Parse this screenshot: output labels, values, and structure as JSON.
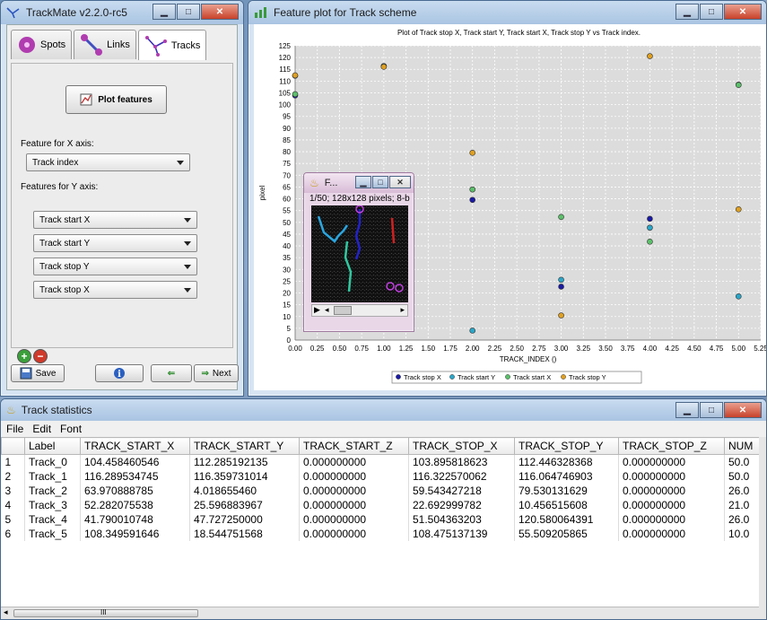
{
  "trackmate": {
    "title": "TrackMate v2.2.0-rc5",
    "tabs": [
      {
        "label": "Spots"
      },
      {
        "label": "Links"
      },
      {
        "label": "Tracks"
      }
    ],
    "plot_button": "Plot features",
    "x_axis_label": "Feature for X axis:",
    "x_axis_value": "Track index",
    "y_axis_label": "Features for Y axis:",
    "y_features": [
      "Track start X",
      "Track start Y",
      "Track stop Y",
      "Track stop X"
    ],
    "buttons": {
      "save": "Save",
      "next": "Next"
    }
  },
  "plot_window": {
    "title": "Feature plot for Track scheme"
  },
  "chart_data": {
    "type": "scatter",
    "title": "Plot of Track stop X, Track start Y, Track start X, Track stop Y vs Track index.",
    "xlabel": "TRACK_INDEX ()",
    "ylabel": "pixel",
    "xlim": [
      0,
      5.25
    ],
    "ylim": [
      0,
      125
    ],
    "xticks": [
      "0.00",
      "0.25",
      "0.50",
      "0.75",
      "1.00",
      "1.25",
      "1.50",
      "1.75",
      "2.00",
      "2.25",
      "2.50",
      "2.75",
      "3.00",
      "3.25",
      "3.50",
      "3.75",
      "4.00",
      "4.25",
      "4.50",
      "4.75",
      "5.00",
      "5.25"
    ],
    "yticks": [
      "0",
      "5",
      "10",
      "15",
      "20",
      "25",
      "30",
      "35",
      "40",
      "45",
      "50",
      "55",
      "60",
      "65",
      "70",
      "75",
      "80",
      "85",
      "90",
      "95",
      "100",
      "105",
      "110",
      "115",
      "120",
      "125"
    ],
    "grid": true,
    "legend_position": "bottom",
    "x": [
      0,
      1,
      2,
      3,
      4,
      5
    ],
    "series": [
      {
        "name": "Track stop X",
        "color": "#1a1aa6",
        "values": [
          103.895818623,
          116.322570062,
          59.543427218,
          22.692999782,
          51.504363203,
          108.475137139
        ]
      },
      {
        "name": "Track start Y",
        "color": "#2aa6c8",
        "values": [
          112.285192135,
          116.359731014,
          4.01865546,
          25.596883967,
          47.72725,
          18.544751568
        ]
      },
      {
        "name": "Track start X",
        "color": "#5bc06a",
        "values": [
          104.458460546,
          116.289534745,
          63.970888785,
          52.282075538,
          41.790010748,
          108.349591646
        ]
      },
      {
        "name": "Track stop Y",
        "color": "#e0a020",
        "values": [
          112.446328368,
          116.064746903,
          79.530131629,
          10.456515608,
          120.580064391,
          55.509205865
        ]
      }
    ]
  },
  "image_window": {
    "title": "F...",
    "info": "1/50; 128x128 pixels; 8-bit"
  },
  "stats": {
    "title": "Track statistics",
    "menu": [
      "File",
      "Edit",
      "Font"
    ],
    "columns": [
      "",
      "Label",
      "TRACK_START_X",
      "TRACK_START_Y",
      "TRACK_START_Z",
      "TRACK_STOP_X",
      "TRACK_STOP_Y",
      "TRACK_STOP_Z",
      "NUM"
    ],
    "rows": [
      [
        "1",
        "Track_0",
        "104.458460546",
        "112.285192135",
        "0.000000000",
        "103.895818623",
        "112.446328368",
        "0.000000000",
        "50.0"
      ],
      [
        "2",
        "Track_1",
        "116.289534745",
        "116.359731014",
        "0.000000000",
        "116.322570062",
        "116.064746903",
        "0.000000000",
        "50.0"
      ],
      [
        "3",
        "Track_2",
        "63.970888785",
        "4.018655460",
        "0.000000000",
        "59.543427218",
        "79.530131629",
        "0.000000000",
        "26.0"
      ],
      [
        "4",
        "Track_3",
        "52.282075538",
        "25.596883967",
        "0.000000000",
        "22.692999782",
        "10.456515608",
        "0.000000000",
        "21.0"
      ],
      [
        "5",
        "Track_4",
        "41.790010748",
        "47.727250000",
        "0.000000000",
        "51.504363203",
        "120.580064391",
        "0.000000000",
        "26.0"
      ],
      [
        "6",
        "Track_5",
        "108.349591646",
        "18.544751568",
        "0.000000000",
        "108.475137139",
        "55.509205865",
        "0.000000000",
        "10.0"
      ]
    ],
    "scroll_label": "III"
  }
}
